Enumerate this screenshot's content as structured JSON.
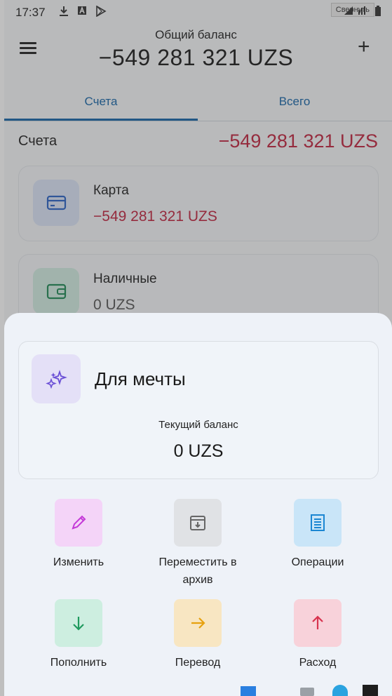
{
  "status_bar": {
    "time": "17:37",
    "collapse_label": "Свернуть"
  },
  "header": {
    "label": "Общий баланс",
    "amount": "−549 281 321 UZS"
  },
  "tabs": [
    {
      "label": "Счета",
      "active": true
    },
    {
      "label": "Всего",
      "active": false
    }
  ],
  "accounts_section": {
    "label": "Счета",
    "total": "−549 281 321 UZS"
  },
  "accounts": [
    {
      "name": "Карта",
      "balance": "−549 281 321 UZS",
      "icon": "credit-card-icon"
    },
    {
      "name": "Наличные",
      "balance": "0 UZS",
      "icon": "wallet-icon"
    }
  ],
  "sheet": {
    "goal": {
      "name": "Для мечты",
      "icon": "sparkles-icon",
      "balance_label": "Текущий баланс",
      "balance": "0 UZS"
    },
    "actions": [
      {
        "label": "Изменить",
        "icon": "pencil-icon"
      },
      {
        "label": "Переместить в архив",
        "icon": "archive-icon"
      },
      {
        "label": "Операции",
        "icon": "receipt-icon"
      },
      {
        "label": "Пополнить",
        "icon": "arrow-down-icon"
      },
      {
        "label": "Перевод",
        "icon": "arrow-right-icon"
      },
      {
        "label": "Расход",
        "icon": "arrow-up-icon"
      }
    ]
  },
  "colors": {
    "accent": "#1565a8",
    "negative": "#c0243f",
    "card_icon_bg": "#dbe4f8",
    "cash_icon_bg": "#d2ede3",
    "goal_icon_bg": "#e4e0f7",
    "edit_bg": "#f4d4f8",
    "archive_bg": "#e0e2e5",
    "operations_bg": "#c9e5f8",
    "topup_bg": "#cdeee0",
    "transfer_bg": "#f8e6c2",
    "expense_bg": "#f8d2da"
  }
}
